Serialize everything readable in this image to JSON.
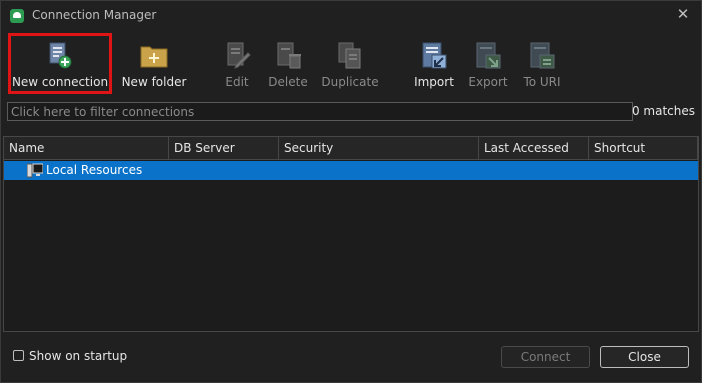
{
  "window": {
    "title": "Connection Manager"
  },
  "colors": {
    "accent": "#0a72c8",
    "highlight": "#e01414",
    "app_icon": "#2e9b52"
  },
  "toolbar": {
    "buttons": [
      {
        "label": "New connection",
        "icon": "new-connection-icon",
        "enabled": true,
        "highlighted": true
      },
      {
        "label": "New folder",
        "icon": "new-folder-icon",
        "enabled": true
      },
      {
        "label": "Edit",
        "icon": "edit-icon",
        "enabled": false
      },
      {
        "label": "Delete",
        "icon": "delete-icon",
        "enabled": false
      },
      {
        "label": "Duplicate",
        "icon": "duplicate-icon",
        "enabled": false
      },
      {
        "label": "Import",
        "icon": "import-icon",
        "enabled": true
      },
      {
        "label": "Export",
        "icon": "export-icon",
        "enabled": false
      },
      {
        "label": "To URI",
        "icon": "to-uri-icon",
        "enabled": false
      }
    ]
  },
  "filter": {
    "placeholder": "Click here to filter connections",
    "matches": "0 matches"
  },
  "table": {
    "columns": [
      "Name",
      "DB Server",
      "Security",
      "Last Accessed",
      "Shortcut"
    ],
    "rows": [
      {
        "name": "Local Resources",
        "icon": "computer-icon",
        "selected": true
      }
    ]
  },
  "footer": {
    "show_on_startup": "Show on startup",
    "show_on_startup_checked": false,
    "connect": "Connect",
    "close": "Close"
  }
}
